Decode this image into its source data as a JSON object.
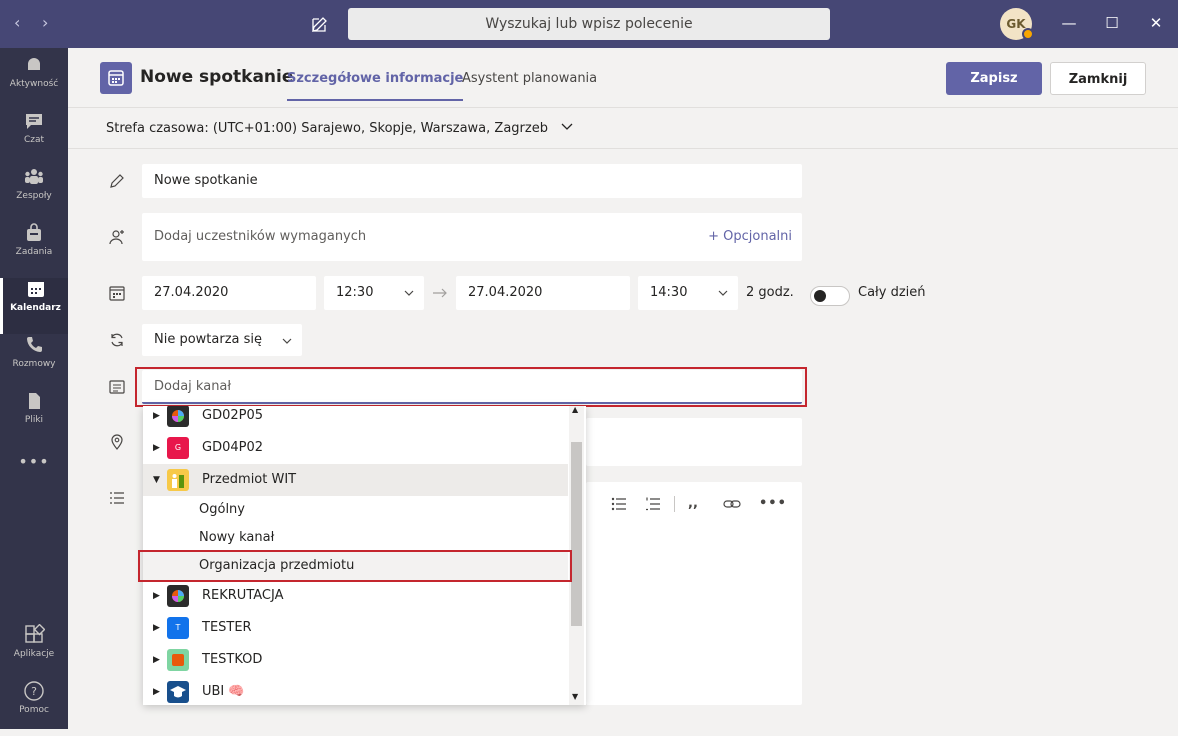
{
  "search": {
    "placeholder": "Wyszukaj lub wpisz polecenie"
  },
  "user": {
    "initials": "GK"
  },
  "window": {
    "minimize": "—",
    "maximize": "☐",
    "close": "✕"
  },
  "nav": {
    "back": "‹",
    "forward": "›"
  },
  "rail": [
    {
      "label": "Aktywność",
      "icon": "bell-icon"
    },
    {
      "label": "Czat",
      "icon": "chat-icon"
    },
    {
      "label": "Zespoły",
      "icon": "teams-icon"
    },
    {
      "label": "Zadania",
      "icon": "bag-icon"
    },
    {
      "label": "Kalendarz",
      "icon": "calendar-icon",
      "active": true
    },
    {
      "label": "Rozmowy",
      "icon": "phone-icon"
    },
    {
      "label": "Pliki",
      "icon": "file-icon"
    },
    {
      "label": "•••",
      "icon": "more-icon"
    },
    {
      "label": "Aplikacje",
      "icon": "apps-icon"
    },
    {
      "label": "Pomoc",
      "icon": "help-icon"
    }
  ],
  "header": {
    "title": "Nowe spotkanie",
    "tabs": [
      "Szczegółowe informacje",
      "Asystent planowania"
    ],
    "save": "Zapisz",
    "close": "Zamknij"
  },
  "timezone": "Strefa czasowa: (UTC+01:00) Sarajewo, Skopje, Warszawa, Zagrzeb",
  "form": {
    "title_value": "Nowe spotkanie",
    "attendees_placeholder": "Dodaj uczestników wymaganych",
    "optional": "+ Opcjonalni",
    "start_date": "27.04.2020",
    "start_time": "12:30",
    "end_date": "27.04.2020",
    "end_time": "14:30",
    "duration": "2 godz.",
    "all_day": "Cały dzień",
    "repeat": "Nie powtarza się",
    "channel_placeholder": "Dodaj kanał"
  },
  "colors": {
    "accent": "#6264a7",
    "titlebar": "#464775",
    "rail": "#33344a",
    "highlight": "#c4262e"
  },
  "dropdown": {
    "teams": [
      {
        "name": "GD02P05",
        "color": "#2b2b2b",
        "expanded": false
      },
      {
        "name": "GD04P02",
        "color": "#e8174b",
        "expanded": false,
        "initial": "G"
      },
      {
        "name": "Przedmiot WIT",
        "color": "#f7c948",
        "expanded": true
      },
      {
        "name": "REKRUTACJA",
        "color": "#2b2b2b",
        "expanded": false
      },
      {
        "name": "TESTER",
        "color": "#1273eb",
        "expanded": false,
        "initial": "T"
      },
      {
        "name": "TESTKOD",
        "color": "#7fd5a2",
        "expanded": false
      },
      {
        "name": "UBI 🧠",
        "color": "#184f8c",
        "expanded": false
      }
    ],
    "channels": [
      "Ogólny",
      "Nowy kanał",
      "Organizacja przedmiotu"
    ]
  }
}
